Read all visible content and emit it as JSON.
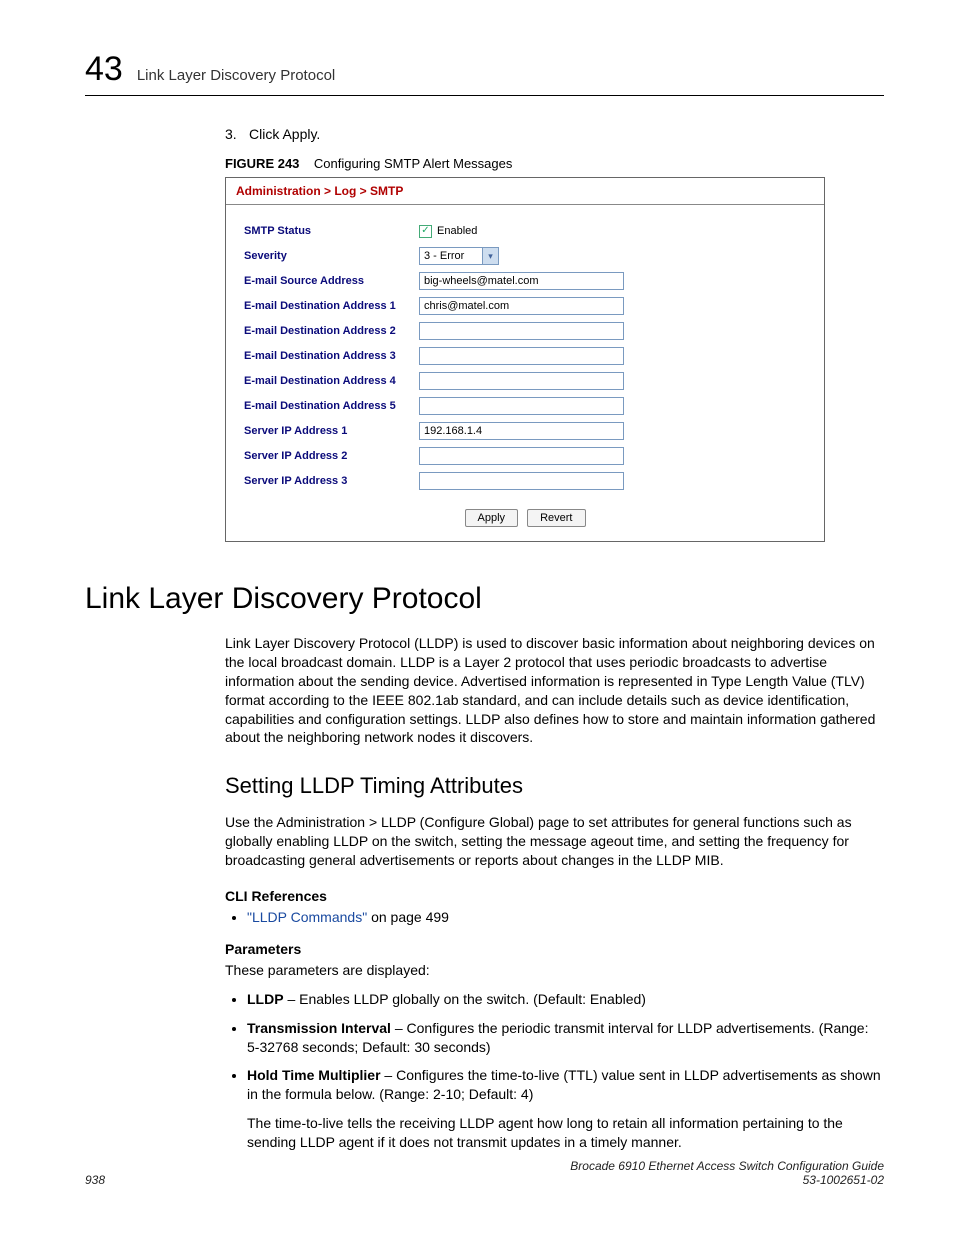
{
  "header": {
    "chapter_number": "43",
    "title": "Link Layer Discovery Protocol"
  },
  "step": {
    "num": "3.",
    "text": "Click Apply."
  },
  "figure": {
    "label": "FIGURE 243",
    "caption": "Configuring SMTP Alert Messages"
  },
  "panel": {
    "breadcrumb": "Administration > Log > SMTP",
    "fields": {
      "smtp_status_label": "SMTP Status",
      "smtp_status_value": "Enabled",
      "severity_label": "Severity",
      "severity_value": "3 - Error",
      "src_label": "E-mail Source Address",
      "src_value": "big-wheels@matel.com",
      "dest1_label": "E-mail Destination Address 1",
      "dest1_value": "chris@matel.com",
      "dest2_label": "E-mail Destination Address 2",
      "dest2_value": "",
      "dest3_label": "E-mail Destination Address 3",
      "dest3_value": "",
      "dest4_label": "E-mail Destination Address 4",
      "dest4_value": "",
      "dest5_label": "E-mail Destination Address 5",
      "dest5_value": "",
      "ip1_label": "Server IP Address 1",
      "ip1_value": "192.168.1.4",
      "ip2_label": "Server IP Address 2",
      "ip2_value": "",
      "ip3_label": "Server IP Address 3",
      "ip3_value": ""
    },
    "buttons": {
      "apply": "Apply",
      "revert": "Revert"
    }
  },
  "section": {
    "title": "Link Layer Discovery Protocol",
    "intro": "Link Layer Discovery Protocol (LLDP) is used to discover basic information about neighboring devices on the local broadcast domain. LLDP is a Layer 2 protocol that uses periodic broadcasts to advertise information about the sending device. Advertised information is represented in Type Length Value (TLV) format according to the IEEE 802.1ab standard, and can include details such as device identification, capabilities and configuration settings. LLDP also defines how to store and maintain information gathered about the neighboring network nodes it discovers."
  },
  "subsection": {
    "title": "Setting LLDP Timing Attributes",
    "intro": "Use the Administration > LLDP (Configure Global) page to set attributes for general functions such as globally enabling LLDP on the switch, setting the message ageout time, and setting the frequency for broadcasting general advertisements or reports about changes in the LLDP MIB.",
    "cli_ref_head": "CLI References",
    "cli_ref_link": "\"LLDP Commands\"",
    "cli_ref_tail": " on page 499",
    "params_head": "Parameters",
    "params_intro": "These parameters are displayed:"
  },
  "params": {
    "lldp_b": "LLDP",
    "lldp_t": " – Enables LLDP globally on the switch. (Default: Enabled)",
    "ti_b": "Transmission Interval",
    "ti_t": " – Configures the periodic transmit interval for LLDP advertisements. (Range: 5-32768 seconds; Default: 30 seconds)",
    "htm_b": "Hold Time Multiplier",
    "htm_t": " – Configures the time-to-live (TTL) value sent in LLDP advertisements as shown in the formula below. (Range: 2-10; Default: 4)",
    "ttl_note": "The time-to-live tells the receiving LLDP agent how long to retain all information pertaining to the sending LLDP agent if it does not transmit updates in a timely manner."
  },
  "footer": {
    "page": "938",
    "guide": "Brocade 6910 Ethernet Access Switch Configuration Guide",
    "docnum": "53-1002651-02"
  }
}
